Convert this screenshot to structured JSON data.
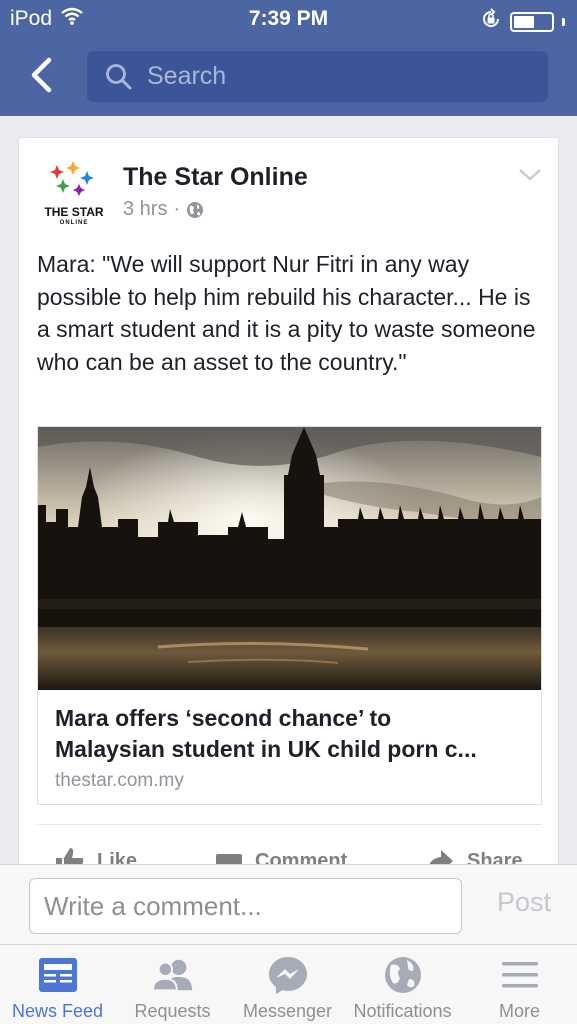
{
  "status_bar": {
    "carrier": "iPod",
    "time": "7:39 PM",
    "battery_level": 0.55
  },
  "nav": {
    "search_placeholder": "Search"
  },
  "post": {
    "page_name": "The Star Online",
    "logo_text": "THE STAR",
    "logo_subtext": "ONLINE",
    "time_ago": "3 hrs",
    "separator": "·",
    "text": "Mara: \"We will support Nur Fitri in any way possible to help him rebuild his character... He is a smart student and it is a pity to waste someone who can be an asset to the country.\"",
    "link": {
      "title_line1": "Mara offers ‘second chance’ to",
      "title_line2": "Malaysian student in UK child porn c...",
      "domain": "thestar.com.my"
    },
    "actions": {
      "like": "Like",
      "comment": "Comment",
      "share": "Share"
    }
  },
  "comment_bar": {
    "placeholder": "Write a comment...",
    "post_label": "Post"
  },
  "tabs": [
    {
      "label": "News Feed",
      "icon": "news-feed-icon",
      "active": true
    },
    {
      "label": "Requests",
      "icon": "requests-icon",
      "active": false
    },
    {
      "label": "Messenger",
      "icon": "messenger-icon",
      "active": false
    },
    {
      "label": "Notifications",
      "icon": "globe-icon",
      "active": false
    },
    {
      "label": "More",
      "icon": "menu-icon",
      "active": false
    }
  ],
  "colors": {
    "nav_blue": "#4c66a4",
    "search_blue": "#3b5598",
    "active_tab": "#4a76d4",
    "inactive_icon": "#a5acb8"
  }
}
